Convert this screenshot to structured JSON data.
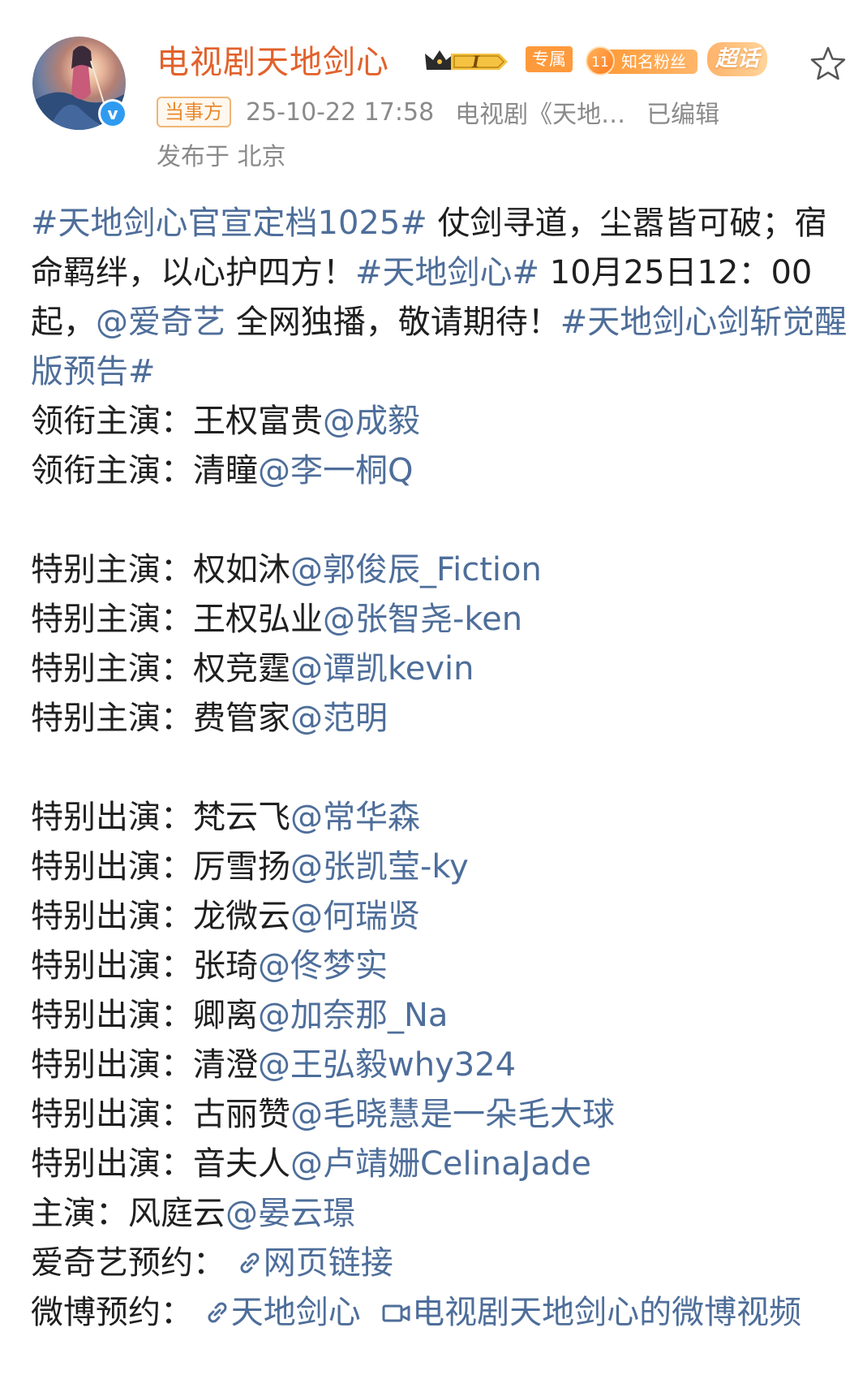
{
  "header": {
    "name": "电视剧天地剑心",
    "crown_level": "I",
    "exclusive_badge": "专属",
    "fan_level": "11",
    "fan_label": "知名粉丝",
    "super_topic": "超话",
    "party_tag": "当事方",
    "timestamp": "25-10-22 17:58",
    "source": "电视剧《天地…",
    "edited": "已编辑",
    "location": "发布于 北京",
    "verified_mark": "v"
  },
  "post": {
    "hashtag1": "#天地剑心官宣定档1025#",
    "text1": " 仗剑寻道，尘嚣皆可破；宿命羁绊，以心护四方！",
    "hashtag2": "#天地剑心#",
    "text2": " 10月25日12：00起，",
    "mention_iqiyi": "@爱奇艺",
    "text3": " 全网独播，敬请期待！",
    "hashtag3": "#天地剑心剑斩觉醒版预告#",
    "cast": [
      {
        "role": "领衔主演：",
        "char": "王权富贵",
        "actor": "@成毅"
      },
      {
        "role": "领衔主演：",
        "char": "清瞳",
        "actor": "@李一桐Q"
      },
      {
        "role": "特别主演：",
        "char": "权如沐",
        "actor": "@郭俊辰_Fiction"
      },
      {
        "role": "特别主演：",
        "char": "王权弘业",
        "actor": "@张智尧-ken"
      },
      {
        "role": "特别主演：",
        "char": "权竞霆",
        "actor": "@谭凯kevin"
      },
      {
        "role": "特别主演：",
        "char": "费管家",
        "actor": "@范明"
      },
      {
        "role": "特别出演：",
        "char": "梵云飞",
        "actor": "@常华森"
      },
      {
        "role": "特别出演：",
        "char": "厉雪扬",
        "actor": "@张凯莹-ky"
      },
      {
        "role": "特别出演：",
        "char": "龙微云",
        "actor": "@何瑞贤"
      },
      {
        "role": "特别出演：",
        "char": "张琦",
        "actor": "@佟梦实"
      },
      {
        "role": "特别出演：",
        "char": "卿离",
        "actor": "@加奈那_Na"
      },
      {
        "role": "特别出演：",
        "char": "清澄",
        "actor": "@王弘毅why324"
      },
      {
        "role": "特别出演：",
        "char": "古丽赞",
        "actor": "@毛晓慧是一朵毛大球"
      },
      {
        "role": "特别出演：",
        "char": "音夫人",
        "actor": "@卢靖姗CelinaJade"
      },
      {
        "role": "主演：",
        "char": "风庭云",
        "actor": "@晏云璟"
      }
    ],
    "iqiyi_reserve_label": "爱奇艺预约：",
    "iqiyi_reserve_link": "网页链接",
    "weibo_reserve_label": "微博预约：",
    "weibo_reserve_link": "天地剑心",
    "video_link": "电视剧天地剑心的微博视频"
  },
  "colors": {
    "name": "#e2612b",
    "link": "#4e6e9a",
    "meta": "#8a8a8a",
    "text": "#1f1f1f"
  }
}
